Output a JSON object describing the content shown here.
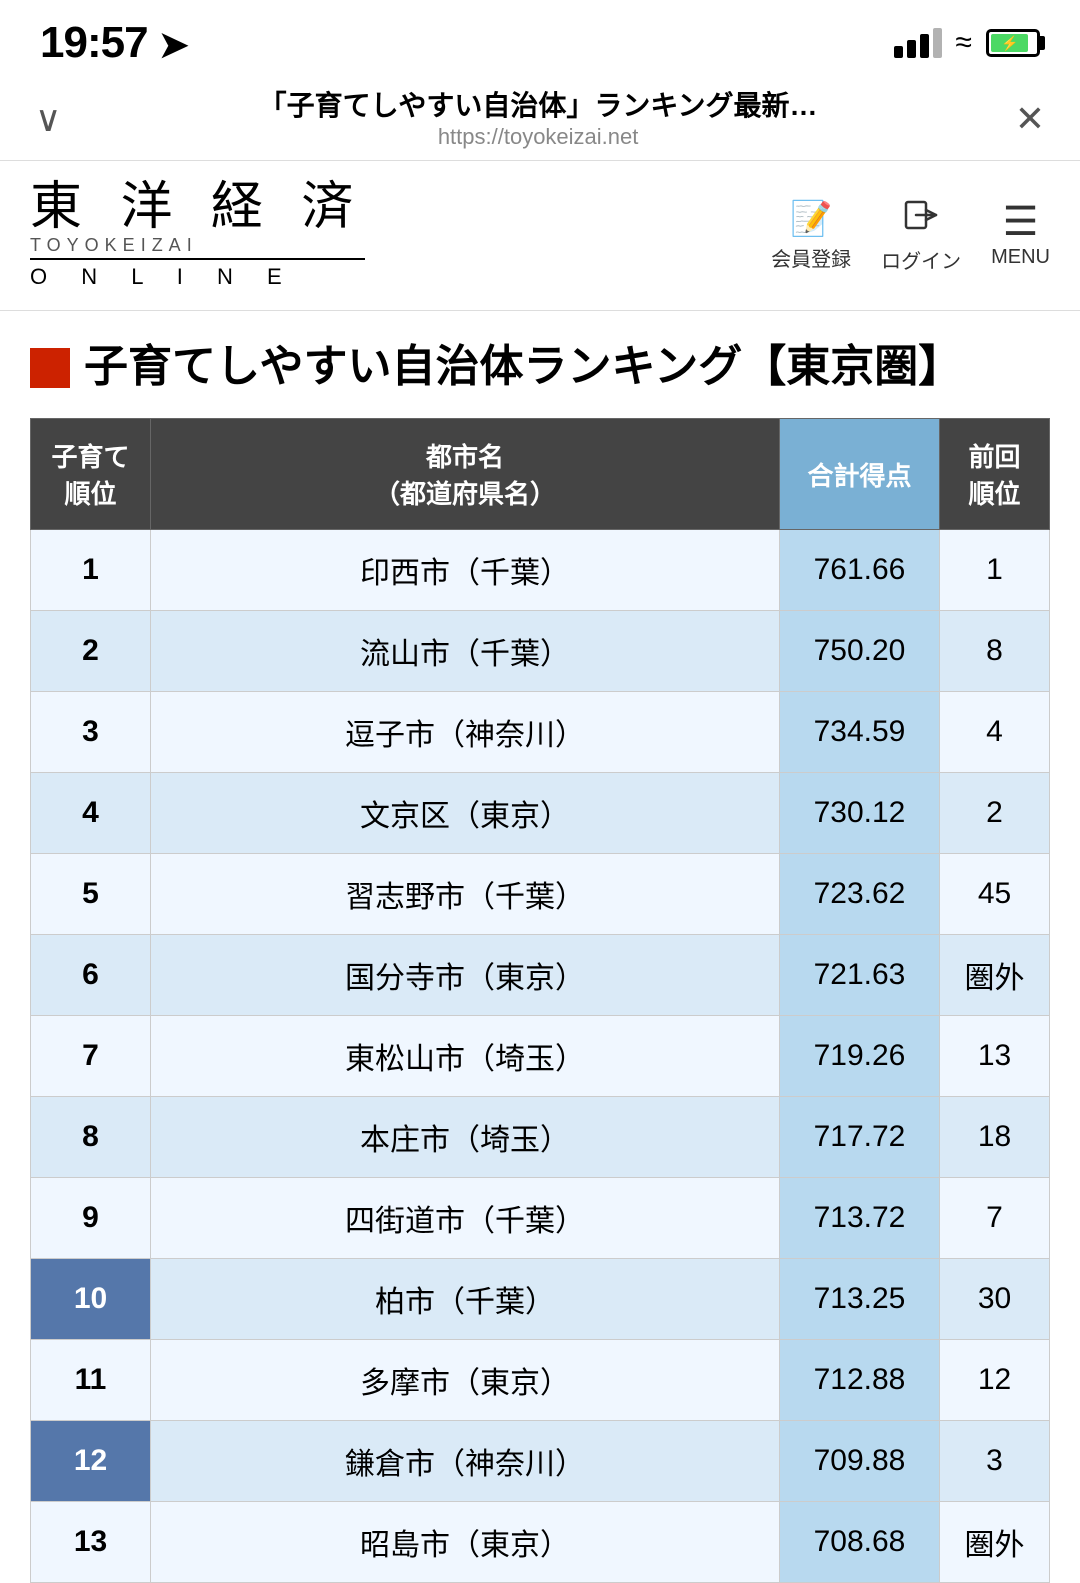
{
  "statusBar": {
    "time": "19:57",
    "locationArrow": "↗",
    "url": "https://toyokeizai.net"
  },
  "browserBar": {
    "title": "「子育てしやすい自治体」ランキング最新…",
    "url": "https://toyokeizai.net",
    "chevron": "∨",
    "close": "✕"
  },
  "siteHeader": {
    "logoKanji": "東 洋 経 済",
    "logoRoman": "TOYOKEIZAI",
    "logoOnline": "O N L I N E",
    "nav": [
      {
        "icon": "📝",
        "label": "会員登録"
      },
      {
        "icon": "🚪",
        "label": "ログイン"
      },
      {
        "icon": "≡",
        "label": "MENU"
      }
    ]
  },
  "rankingSection": {
    "title": "子育てしやすい自治体ランキング【東京圏】",
    "tableHeaders": {
      "rank": "子育て\n順位",
      "city": "都市名\n（都道府県名）",
      "score": "合計得点",
      "prev": "前回\n順位"
    },
    "rows": [
      {
        "rank": "1",
        "city": "印西市（千葉）",
        "score": "761.66",
        "prev": "1",
        "rankDark": false
      },
      {
        "rank": "2",
        "city": "流山市（千葉）",
        "score": "750.20",
        "prev": "8",
        "rankDark": false
      },
      {
        "rank": "3",
        "city": "逗子市（神奈川）",
        "score": "734.59",
        "prev": "4",
        "rankDark": false
      },
      {
        "rank": "4",
        "city": "文京区（東京）",
        "score": "730.12",
        "prev": "2",
        "rankDark": false
      },
      {
        "rank": "5",
        "city": "習志野市（千葉）",
        "score": "723.62",
        "prev": "45",
        "rankDark": false
      },
      {
        "rank": "6",
        "city": "国分寺市（東京）",
        "score": "721.63",
        "prev": "圏外",
        "rankDark": false
      },
      {
        "rank": "7",
        "city": "東松山市（埼玉）",
        "score": "719.26",
        "prev": "13",
        "rankDark": false
      },
      {
        "rank": "8",
        "city": "本庄市（埼玉）",
        "score": "717.72",
        "prev": "18",
        "rankDark": false
      },
      {
        "rank": "9",
        "city": "四街道市（千葉）",
        "score": "713.72",
        "prev": "7",
        "rankDark": false
      },
      {
        "rank": "10",
        "city": "柏市（千葉）",
        "score": "713.25",
        "prev": "30",
        "rankDark": true
      },
      {
        "rank": "11",
        "city": "多摩市（東京）",
        "score": "712.88",
        "prev": "12",
        "rankDark": false
      },
      {
        "rank": "12",
        "city": "鎌倉市（神奈川）",
        "score": "709.88",
        "prev": "3",
        "rankDark": true
      },
      {
        "rank": "13",
        "city": "昭島市（東京）",
        "score": "708.68",
        "prev": "圏外",
        "rankDark": false
      }
    ]
  }
}
